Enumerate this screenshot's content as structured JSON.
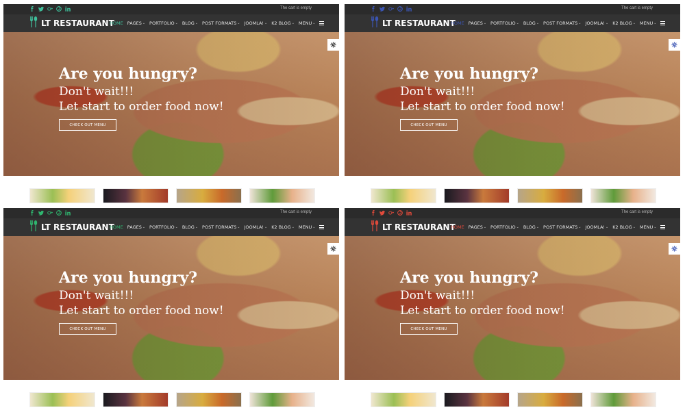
{
  "panels": [
    {
      "topbar": {
        "cart_text": "The cart is empty"
      },
      "navbar": {
        "logo_text": "LT RESTAURANT",
        "menu": [
          {
            "label": "HOME",
            "has_chevron": false,
            "active": true
          },
          {
            "label": "PAGES",
            "has_chevron": true
          },
          {
            "label": "PORTFOLIO",
            "has_chevron": true
          },
          {
            "label": "BLOG",
            "has_chevron": true
          },
          {
            "label": "POST FORMATS",
            "has_chevron": true
          },
          {
            "label": "JOOMLA!",
            "has_chevron": true
          },
          {
            "label": "K2 BLOG",
            "has_chevron": true
          },
          {
            "label": "MENU",
            "has_chevron": true
          }
        ]
      },
      "hero": {
        "title": "Are you hungry?",
        "line1": "Don't wait!!!",
        "line2": "Let start to order food now!",
        "button_label": "CHECK OUT MENU"
      },
      "accent_color": "#3fbf9b"
    },
    {
      "topbar": {
        "cart_text": "The cart is empty"
      },
      "navbar": {
        "logo_text": "LT RESTAURANT",
        "menu": [
          {
            "label": "HOME",
            "has_chevron": false,
            "active": true
          },
          {
            "label": "PAGES",
            "has_chevron": true
          },
          {
            "label": "PORTFOLIO",
            "has_chevron": true
          },
          {
            "label": "BLOG",
            "has_chevron": true
          },
          {
            "label": "POST FORMATS",
            "has_chevron": true
          },
          {
            "label": "JOOMLA!",
            "has_chevron": true
          },
          {
            "label": "K2 BLOG",
            "has_chevron": true
          },
          {
            "label": "MENU",
            "has_chevron": true
          }
        ]
      },
      "hero": {
        "title": "Are you hungry?",
        "line1": "Don't wait!!!",
        "line2": "Let start to order food now!",
        "button_label": "CHECK OUT MENU"
      },
      "accent_color": "#3b55b3"
    },
    {
      "topbar": {
        "cart_text": "The cart is empty"
      },
      "navbar": {
        "logo_text": "LT RESTAURANT",
        "menu": [
          {
            "label": "HOME",
            "has_chevron": false,
            "active": true
          },
          {
            "label": "PAGES",
            "has_chevron": true
          },
          {
            "label": "PORTFOLIO",
            "has_chevron": true
          },
          {
            "label": "BLOG",
            "has_chevron": true
          },
          {
            "label": "POST FORMATS",
            "has_chevron": true
          },
          {
            "label": "JOOMLA!",
            "has_chevron": true
          },
          {
            "label": "K2 BLOG",
            "has_chevron": true
          },
          {
            "label": "MENU",
            "has_chevron": true
          }
        ]
      },
      "hero": {
        "title": "Are you hungry?",
        "line1": "Don't wait!!!",
        "line2": "Let start to order food now!",
        "button_label": "CHECK OUT MENU"
      },
      "accent_color": "#2fb56f"
    },
    {
      "topbar": {
        "cart_text": "The cart is empty"
      },
      "navbar": {
        "logo_text": "LT RESTAURANT",
        "menu": [
          {
            "label": "HOME",
            "has_chevron": false,
            "active": true
          },
          {
            "label": "PAGES",
            "has_chevron": true
          },
          {
            "label": "PORTFOLIO",
            "has_chevron": true
          },
          {
            "label": "BLOG",
            "has_chevron": true
          },
          {
            "label": "POST FORMATS",
            "has_chevron": true
          },
          {
            "label": "JOOMLA!",
            "has_chevron": true
          },
          {
            "label": "K2 BLOG",
            "has_chevron": true
          },
          {
            "label": "MENU",
            "has_chevron": true
          }
        ]
      },
      "hero": {
        "title": "Are you hungry?",
        "line1": "Don't wait!!!",
        "line2": "Let start to order food now!",
        "button_label": "CHECK OUT MENU"
      },
      "accent_color": "#e04a3b"
    }
  ],
  "icons": {
    "social": [
      "facebook-icon",
      "twitter-icon",
      "google-plus-icon",
      "pinterest-icon",
      "linkedin-icon"
    ],
    "logo": "fork-spoon-icon",
    "settings": "gear-icon",
    "menu": "hamburger-icon"
  },
  "colors": {
    "topbar_bg": "#2b2b2b",
    "navbar_bg": "#333333",
    "text_light": "#ffffff"
  }
}
